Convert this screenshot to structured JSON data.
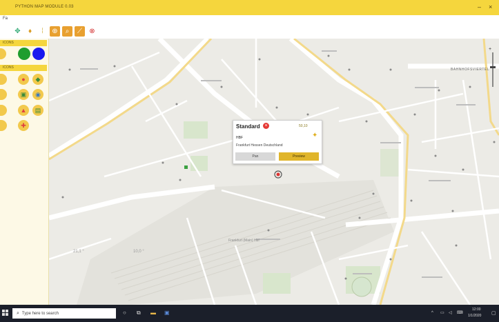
{
  "window": {
    "title": "PYTHON MAP MODULE 0.03"
  },
  "menu": {
    "label": "Fa"
  },
  "sidebar": {
    "section1": "ICONS",
    "section2": "ICONS"
  },
  "map": {
    "labels": [
      {
        "text": "BAHNHOFSVIERTEL"
      },
      {
        "text": "Frankfurt (Main) Hbf"
      }
    ]
  },
  "popup": {
    "title": "Standard",
    "coord": "50,10",
    "name": "HBF",
    "address": "Frankfurt Hessen Deutschland",
    "btn_left": "Pan",
    "btn_right": "Preview"
  },
  "coords": {
    "left": "21,1 °",
    "right": "10,0 °"
  },
  "taskbar": {
    "search_placeholder": "Type here to search",
    "clock_time": "12:00",
    "clock_date": "1/1/2020"
  },
  "colors": {
    "titlebar": "#f5d63d",
    "accent": "#f2c94c",
    "map_bg": "#ecebe6",
    "taskbar": "#1b1f2a"
  }
}
